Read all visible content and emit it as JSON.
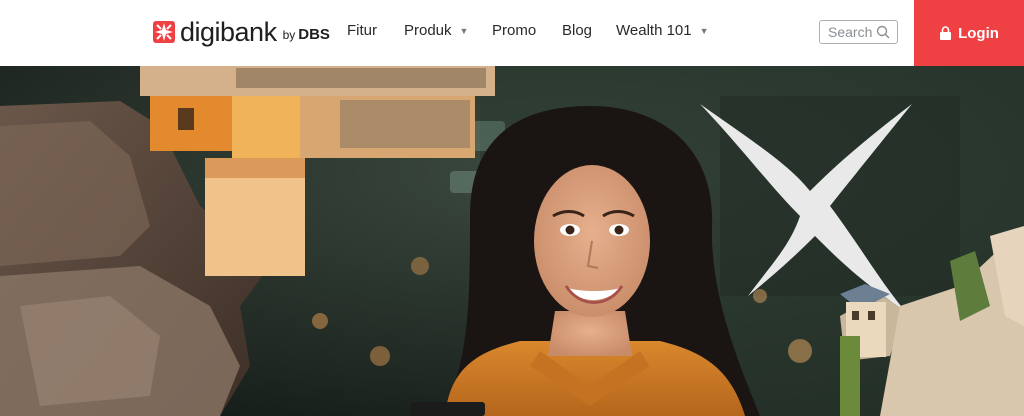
{
  "brand": {
    "name": "digibank",
    "by": "by",
    "company": "DBS",
    "logo_icon": "dbs-star-icon",
    "accent_color": "#ef4044"
  },
  "nav": {
    "items": [
      {
        "label": "Fitur",
        "has_dropdown": false
      },
      {
        "label": "Produk",
        "has_dropdown": true
      },
      {
        "label": "Promo",
        "has_dropdown": false
      },
      {
        "label": "Blog",
        "has_dropdown": false
      },
      {
        "label": "Wealth 101",
        "has_dropdown": true
      }
    ],
    "dropdown_icon": "chevron-down-icon"
  },
  "search": {
    "placeholder": "Search",
    "icon": "search-icon"
  },
  "login": {
    "label": "Login",
    "icon": "lock-icon",
    "color": "#ef4044"
  },
  "hero": {
    "image": "hero-banner-photo"
  }
}
